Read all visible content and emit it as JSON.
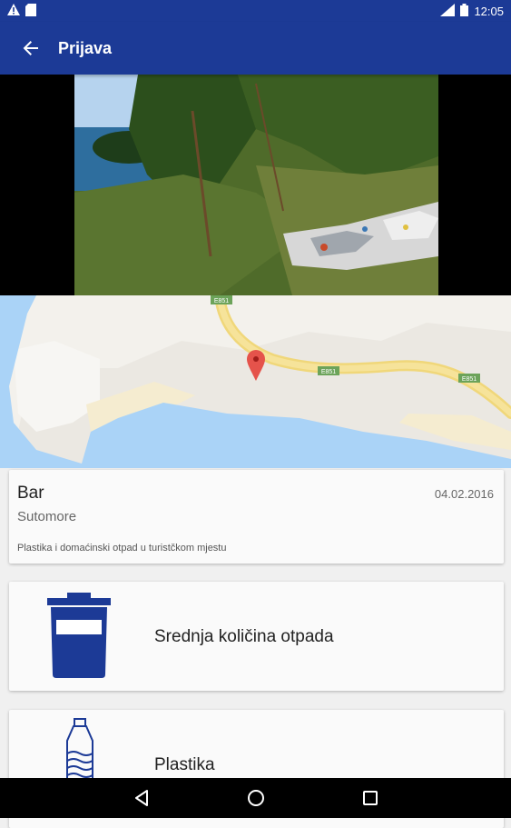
{
  "status_bar": {
    "time": "12:05",
    "icons": [
      "warning-icon",
      "sd-card-icon",
      "signal-icon",
      "battery-icon"
    ]
  },
  "app_bar": {
    "title": "Prijava",
    "back_icon": "arrow-back-icon",
    "color": "#1c3a96"
  },
  "map": {
    "road_label_1": "E851",
    "road_label_2": "E851",
    "road_label_3": "E851"
  },
  "report": {
    "city": "Bar",
    "area": "Sutomore",
    "date": "04.02.2016",
    "description": "Plastika i domaćinski otpad u turistčkom mjestu"
  },
  "waste_items": [
    {
      "label": "Srednja količina otpada",
      "icon": "trash-bin-icon"
    },
    {
      "label": "Plastika",
      "icon": "plastic-bottle-icon"
    }
  ],
  "nav": {
    "back": "nav-back-icon",
    "home": "nav-home-icon",
    "recents": "nav-recents-icon"
  }
}
